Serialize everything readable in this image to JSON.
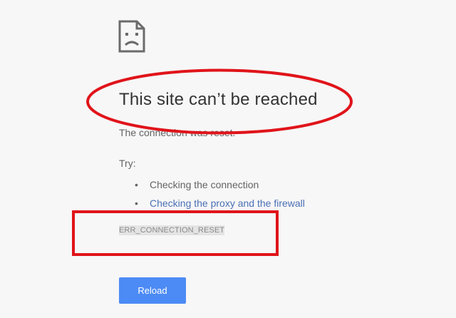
{
  "error_page": {
    "title": "This site can’t be reached",
    "subtitle": "The connection was reset.",
    "try_label": "Try:",
    "suggestions": [
      {
        "label": "Checking the connection",
        "link": false
      },
      {
        "label": "Checking the proxy and the firewall",
        "link": true
      }
    ],
    "error_code": "ERR_CONNECTION_RESET",
    "reload_label": "Reload",
    "bullet": "•"
  },
  "icons": {
    "error": "sad-page-icon"
  },
  "annotations": {
    "color": "#e0141a",
    "title_highlight": "ellipse",
    "error_code_highlight": "rectangle"
  },
  "colors": {
    "background": "#f7f7f7",
    "title_text": "#333333",
    "body_text": "#646464",
    "link": "#4a6fb5",
    "button": "#4c8bf5"
  }
}
